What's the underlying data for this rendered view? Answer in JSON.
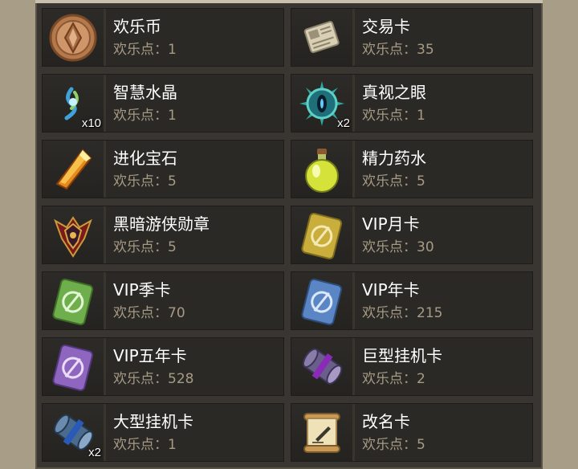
{
  "points_prefix": "欢乐点：",
  "items": [
    {
      "name": "欢乐币",
      "points": "1",
      "qty": "",
      "icon": "coin-icon"
    },
    {
      "name": "交易卡",
      "points": "35",
      "qty": "",
      "icon": "trade-card-icon"
    },
    {
      "name": "智慧水晶",
      "points": "1",
      "qty": "x10",
      "icon": "wisdom-crystal-icon"
    },
    {
      "name": "真视之眼",
      "points": "1",
      "qty": "x2",
      "icon": "true-sight-eye-icon"
    },
    {
      "name": "进化宝石",
      "points": "5",
      "qty": "",
      "icon": "evolution-gem-icon"
    },
    {
      "name": "精力药水",
      "points": "5",
      "qty": "",
      "icon": "energy-potion-icon"
    },
    {
      "name": "黑暗游侠勋章",
      "points": "5",
      "qty": "",
      "icon": "dark-ranger-medal-icon"
    },
    {
      "name": "VIP月卡",
      "points": "30",
      "qty": "",
      "icon": "vip-month-card-icon"
    },
    {
      "name": "VIP季卡",
      "points": "70",
      "qty": "",
      "icon": "vip-season-card-icon"
    },
    {
      "name": "VIP年卡",
      "points": "215",
      "qty": "",
      "icon": "vip-year-card-icon"
    },
    {
      "name": "VIP五年卡",
      "points": "528",
      "qty": "",
      "icon": "vip-five-year-card-icon"
    },
    {
      "name": "巨型挂机卡",
      "points": "2",
      "qty": "",
      "icon": "giant-idle-scroll-icon"
    },
    {
      "name": "大型挂机卡",
      "points": "1",
      "qty": "x2",
      "icon": "large-idle-scroll-icon"
    },
    {
      "name": "改名卡",
      "points": "5",
      "qty": "",
      "icon": "rename-card-icon"
    }
  ],
  "colors": {
    "vip_month": "#c9ae3c",
    "vip_season": "#6fae4c",
    "vip_year": "#5a86c6",
    "vip_five_year": "#8e66c0"
  }
}
